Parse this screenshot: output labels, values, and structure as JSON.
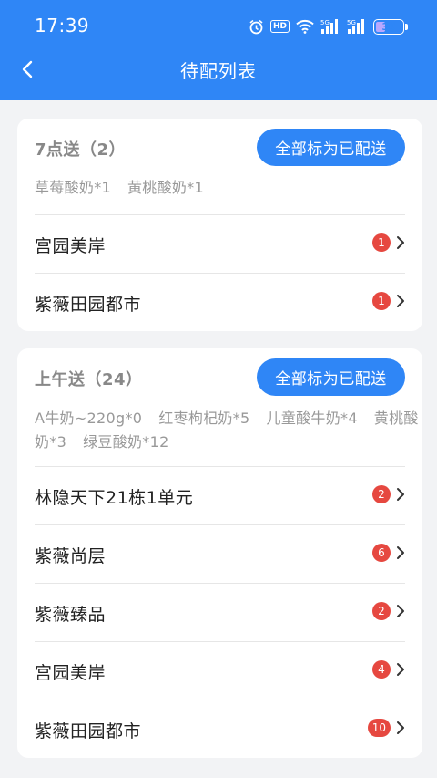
{
  "status_bar": {
    "time": "17:39",
    "battery": "36",
    "battery_level": 0.36,
    "icons": [
      "alarm-icon",
      "hd-icon",
      "wifi-icon",
      "signal-5g-icon",
      "signal-5g-icon",
      "battery-icon"
    ],
    "hd_label": "HD",
    "net_label": "5G"
  },
  "nav": {
    "title": "待配列表",
    "back_icon": "chevron-left-icon"
  },
  "colors": {
    "primary": "#2f86f6",
    "badge": "#e64840",
    "background": "#f2f3f5"
  },
  "groups": [
    {
      "title": "7点送（2）",
      "button_label": "全部标为已配送",
      "products": [
        "草莓酸奶*1",
        "黄桃酸奶*1"
      ],
      "items": [
        {
          "name": "宫园美岸",
          "count": "1"
        },
        {
          "name": "紫薇田园都市",
          "count": "1"
        }
      ]
    },
    {
      "title": "上午送（24）",
      "button_label": "全部标为已配送",
      "products": [
        "A牛奶~220g*0",
        "红枣枸杞奶*5",
        "儿童酸牛奶*4",
        "黄桃酸奶*3",
        "绿豆酸奶*12"
      ],
      "items": [
        {
          "name": "林隐天下21栋1单元",
          "count": "2"
        },
        {
          "name": "紫薇尚层",
          "count": "6"
        },
        {
          "name": "紫薇臻品",
          "count": "2"
        },
        {
          "name": "宫园美岸",
          "count": "4"
        },
        {
          "name": "紫薇田园都市",
          "count": "10"
        }
      ]
    }
  ]
}
